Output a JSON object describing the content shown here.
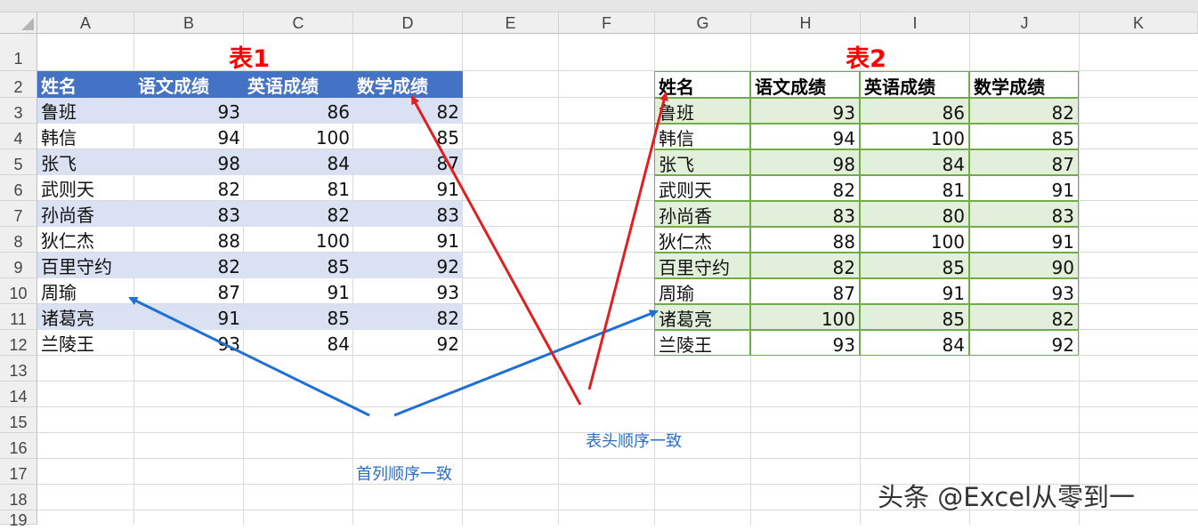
{
  "columns": [
    "A",
    "B",
    "C",
    "D",
    "E",
    "F",
    "G",
    "H",
    "I",
    "J",
    "K"
  ],
  "rows": [
    "1",
    "2",
    "3",
    "4",
    "5",
    "6",
    "7",
    "8",
    "9",
    "10",
    "11",
    "12",
    "13",
    "14",
    "15",
    "16",
    "17",
    "18",
    "19"
  ],
  "table1": {
    "title": "表1",
    "headers": [
      "姓名",
      "语文成绩",
      "英语成绩",
      "数学成绩"
    ],
    "rows": [
      [
        "鲁班",
        "93",
        "86",
        "82"
      ],
      [
        "韩信",
        "94",
        "100",
        "85"
      ],
      [
        "张飞",
        "98",
        "84",
        "87"
      ],
      [
        "武则天",
        "82",
        "81",
        "91"
      ],
      [
        "孙尚香",
        "83",
        "82",
        "83"
      ],
      [
        "狄仁杰",
        "88",
        "100",
        "91"
      ],
      [
        "百里守约",
        "82",
        "85",
        "92"
      ],
      [
        "周瑜",
        "87",
        "91",
        "93"
      ],
      [
        "诸葛亮",
        "91",
        "85",
        "82"
      ],
      [
        "兰陵王",
        "93",
        "84",
        "92"
      ]
    ],
    "header_color": "#4472c4",
    "band_color": "#d9e1f2"
  },
  "table2": {
    "title": "表2",
    "headers": [
      "姓名",
      "语文成绩",
      "英语成绩",
      "数学成绩"
    ],
    "rows": [
      [
        "鲁班",
        "93",
        "86",
        "82"
      ],
      [
        "韩信",
        "94",
        "100",
        "85"
      ],
      [
        "张飞",
        "98",
        "84",
        "87"
      ],
      [
        "武则天",
        "82",
        "81",
        "91"
      ],
      [
        "孙尚香",
        "83",
        "80",
        "83"
      ],
      [
        "狄仁杰",
        "88",
        "100",
        "91"
      ],
      [
        "百里守约",
        "82",
        "85",
        "90"
      ],
      [
        "周瑜",
        "87",
        "91",
        "93"
      ],
      [
        "诸葛亮",
        "100",
        "85",
        "82"
      ],
      [
        "兰陵王",
        "93",
        "84",
        "92"
      ]
    ],
    "band_color": "#e2efda",
    "border_color": "#70ad47"
  },
  "annotations": {
    "first_column_note": "首列顺序一致",
    "header_note": "表头顺序一致",
    "blue_arrow_color": "#1f6fd6",
    "red_arrow_color": "#e02020"
  },
  "watermark": "头条 @Excel从零到一"
}
